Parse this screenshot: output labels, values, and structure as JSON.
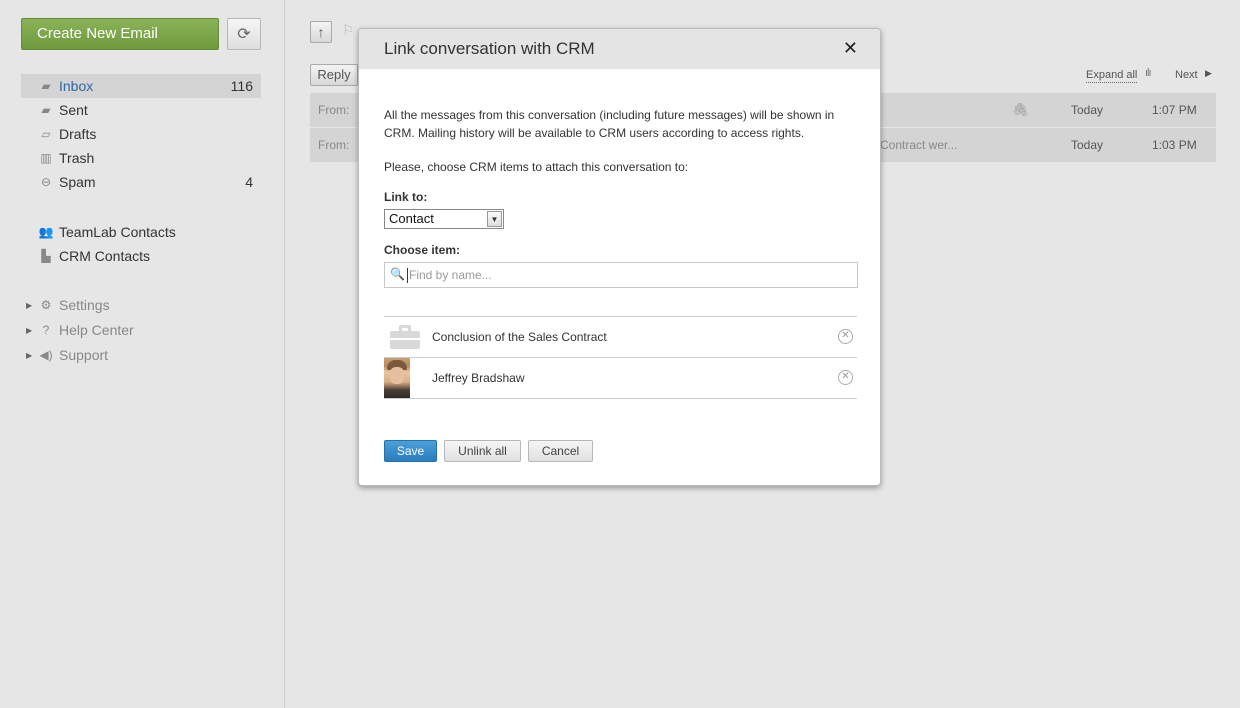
{
  "sidebar": {
    "create_label": "Create New Email",
    "refresh_icon": "refresh-icon",
    "folders": [
      {
        "label": "Inbox",
        "count": "116",
        "icon": "inbox-icon"
      },
      {
        "label": "Sent",
        "count": "",
        "icon": "sent-icon"
      },
      {
        "label": "Drafts",
        "count": "",
        "icon": "drafts-icon"
      },
      {
        "label": "Trash",
        "count": "",
        "icon": "trash-icon"
      },
      {
        "label": "Spam",
        "count": "4",
        "icon": "spam-icon"
      }
    ],
    "contacts": [
      {
        "label": "TeamLab Contacts",
        "icon": "people-icon"
      },
      {
        "label": "CRM Contacts",
        "icon": "crm-icon"
      }
    ],
    "settings": [
      {
        "label": "Settings",
        "icon": "gear-icon"
      },
      {
        "label": "Help Center",
        "icon": "question-icon"
      },
      {
        "label": "Support",
        "icon": "megaphone-icon"
      }
    ]
  },
  "main": {
    "reply_label": "Reply",
    "expand_all_label": "Expand all",
    "next_label": "Next",
    "messages": [
      {
        "from": "From:",
        "snippet": "",
        "day": "Today",
        "time": "1:07 PM",
        "attachment": true
      },
      {
        "from": "From:",
        "snippet": "Contract wer...",
        "day": "Today",
        "time": "1:03 PM",
        "attachment": false
      }
    ]
  },
  "modal": {
    "title": "Link conversation with CRM",
    "close_glyph": "✕",
    "description": "All the messages from this conversation (including future messages) will be shown in CRM. Mailing history will be available to CRM users according to access rights.",
    "choose_text": "Please, choose CRM items to attach this conversation to:",
    "link_to_label": "Link to:",
    "link_to_value": "Contact",
    "choose_item_label": "Choose item:",
    "search_placeholder": "Find by name...",
    "items": [
      {
        "name": "Conclusion of the Sales Contract",
        "kind": "case"
      },
      {
        "name": "Jeffrey Bradshaw",
        "kind": "person"
      }
    ],
    "save_label": "Save",
    "unlink_label": "Unlink all",
    "cancel_label": "Cancel"
  },
  "colors": {
    "accent_green": "#7aa648",
    "accent_blue": "#2a7cbf",
    "active_folder_text": "#2f68a7"
  }
}
